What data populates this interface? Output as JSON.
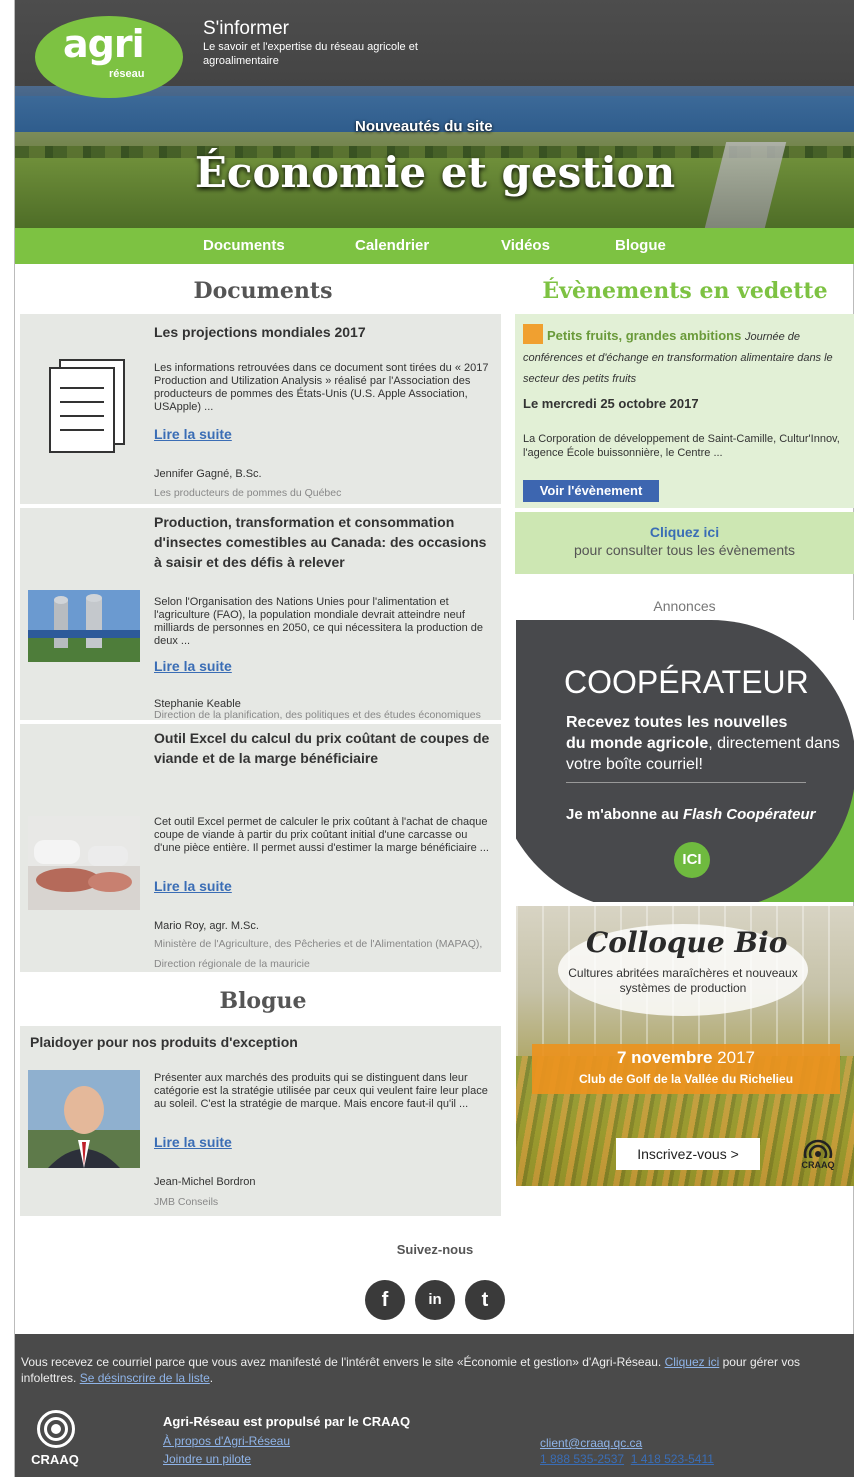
{
  "header": {
    "logo_main": "agri",
    "logo_sub": "réseau",
    "title": "S'informer",
    "subtitle": "Le savoir et l'expertise du réseau agricole et agroalimentaire",
    "banner_kicker": "Nouveautés du site",
    "banner_title": "Économie et gestion"
  },
  "nav": {
    "items": [
      {
        "label": "Documents"
      },
      {
        "label": "Calendrier"
      },
      {
        "label": "Vidéos"
      },
      {
        "label": "Blogue"
      }
    ]
  },
  "documents": {
    "heading": "Documents",
    "items": [
      {
        "title": "Les projections mondiales 2017",
        "excerpt": "Les informations retrouvées dans ce document sont tirées du « 2017 Production and Utilization Analysis » réalisé par l'Association des producteurs de pommes des États-Unis (U.S. Apple Association, USApple) ...",
        "more": "Lire la suite",
        "author": "Jennifer Gagné, B.Sc.",
        "organization": "Les producteurs de pommes du Québec"
      },
      {
        "title": "Production, transformation et consommation d'insectes comestibles au Canada: des occasions à saisir et des défis à relever",
        "excerpt": "Selon l'Organisation des Nations Unies pour l'alimentation et l'agriculture (FAO), la population mondiale devrait atteindre neuf milliards de personnes en 2050, ce qui nécessitera la production de deux ...",
        "more": "Lire la suite",
        "author": "Stephanie Keable",
        "organization": "Direction de la planification, des politiques et des études économiques"
      },
      {
        "title": "Outil Excel du calcul du prix coûtant de coupes de viande et de la marge bénéficiaire",
        "excerpt": "Cet outil Excel permet de calculer le prix coûtant à l'achat de chaque coupe de viande à partir du prix coûtant initial d'une carcasse ou d'une pièce entière. Il permet aussi d'estimer la marge bénéficiaire ...",
        "more": "Lire la suite",
        "author": "Mario Roy, agr. M.Sc.",
        "organization": "Ministère de l'Agriculture, des Pêcheries et de l'Alimentation (MAPAQ), Direction régionale de la mauricie"
      }
    ]
  },
  "events": {
    "heading": "Évènements en vedette",
    "featured": {
      "title": "Petits fruits, grandes ambitions",
      "tagline": "Journée de conférences et d'échange en transformation alimentaire dans le secteur des petits fruits",
      "date": "Le mercredi 25 octobre 2017",
      "description": "La Corporation de développement de Saint-Camille, Cultur'Innov, l'agence École buissonnière, le Centre ...",
      "button": "Voir l'évènement"
    },
    "all_link": "Cliquez ici",
    "all_text": "pour consulter tous les évènements"
  },
  "ads": {
    "heading": "Annonces",
    "cooperateur": {
      "logo": "COOPÉRATEUR",
      "text_line1": "Recevez toutes les nouvelles",
      "text_bold": "du monde agricole",
      "text_line2": ", directement dans votre boîte courriel!",
      "cta_prefix": "Je m'abonne au ",
      "cta_italic": "Flash Coopérateur",
      "badge": "ICI"
    },
    "colloque": {
      "title": "Colloque Bio",
      "subtitle": "Cultures abritées maraîchères et nouveaux systèmes de production",
      "date_bold": "7 novembre",
      "date_year": " 2017",
      "place": "Club de Golf de la Vallée du Richelieu",
      "button": "Inscrivez-vous >",
      "brand": "CRAAQ"
    }
  },
  "blog": {
    "heading": "Blogue",
    "title": "Plaidoyer pour nos produits d'exception",
    "excerpt": "Présenter aux marchés des produits qui se distinguent dans leur catégorie est la stratégie utilisée par ceux qui veulent faire leur place au soleil. C'est la stratégie de marque. Mais encore faut-il qu'il ...",
    "more": "Lire la suite",
    "author": "Jean-Michel Bordron",
    "organization": "JMB Conseils"
  },
  "social": {
    "heading": "Suivez-nous",
    "icons": [
      "facebook-icon",
      "linkedin-icon",
      "twitter-icon"
    ],
    "glyphs": [
      "f",
      "in",
      "t"
    ]
  },
  "footer": {
    "notice": "Vous recevez ce courriel parce que vous avez manifesté de l'intérêt envers le site «Économie et gestion» d'Agri-Réseau. ",
    "manage_link": "Cliquez ici",
    "notice2": " pour gérer vos infolettres. ",
    "unsubscribe_link": "Se désinscrire de la liste",
    "notice3": ".",
    "brand_logo": "CRAAQ",
    "brand_text": "Agri-Réseau est propulsé par le CRAAQ",
    "about_link": "À propos d'Agri-Réseau",
    "pilot_link": "Joindre un pilote",
    "email": "client@craaq.qc.ca",
    "phone1": "1 888 535-2537",
    "phone2": "1 418 523-5411"
  },
  "colors": {
    "brand_green": "#7dc242",
    "dark_gray": "#4a4a4a",
    "link_blue": "#3a6db5",
    "event_bg": "#e2f0d6",
    "card_bg": "#e6e8e4"
  }
}
